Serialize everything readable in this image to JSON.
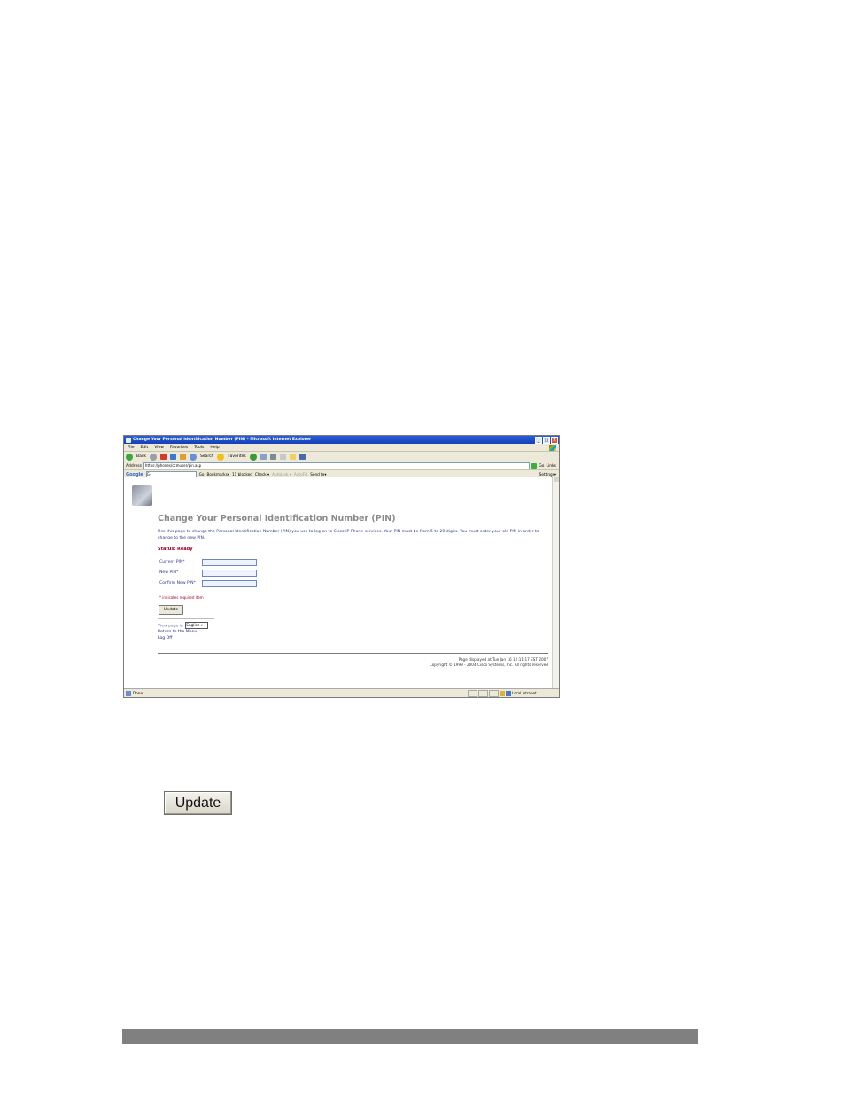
{
  "browser": {
    "window_title": "Change Your Personal Identification Number (PIN) - Microsoft Internet Explorer",
    "menu": [
      "File",
      "Edit",
      "View",
      "Favorites",
      "Tools",
      "Help"
    ],
    "toolbar": {
      "back": "Back",
      "search": "Search",
      "favorites": "Favorites"
    },
    "address_label": "Address",
    "address_url": "https://phones/ccmuser/pin.asp",
    "go_label": "Go",
    "links_label": "Links",
    "google": {
      "logo": "Google",
      "search_prefix": "G-",
      "items": [
        "Go",
        "Bookmarks▾",
        "11 blocked",
        "Check ▾",
        "AutoLink ▾",
        "AutoFill",
        "Send to▾"
      ],
      "settings": "Settings▾"
    },
    "status_left": "Done",
    "status_zone": "Local intranet"
  },
  "page": {
    "title": "Change Your Personal Identification Number (PIN)",
    "intro": "Use this page to change the Personal Identification Number (PIN) you use to log on to Cisco IP Phone services. Your PIN must be from 5 to 20 digits. You must enter your old PIN in order to change to the new PIN.",
    "status": "Status: Ready",
    "fields": {
      "current": "Current PIN*",
      "new": "New PIN*",
      "confirm": "Confirm New PIN*"
    },
    "required_note": "* indicates required item",
    "update_label": "Update",
    "view_page_in": "View page in",
    "language": "English",
    "return_link": "Return to the Menu",
    "logoff_link": "Log Off",
    "footer_line1": "Page displayed at Tue Jan 16 12:11:17 EST 2007",
    "footer_line2": "Copyright © 1999 - 2004 Cisco Systems, Inc. All rights reserved"
  },
  "standalone_button": {
    "label": "Update"
  }
}
